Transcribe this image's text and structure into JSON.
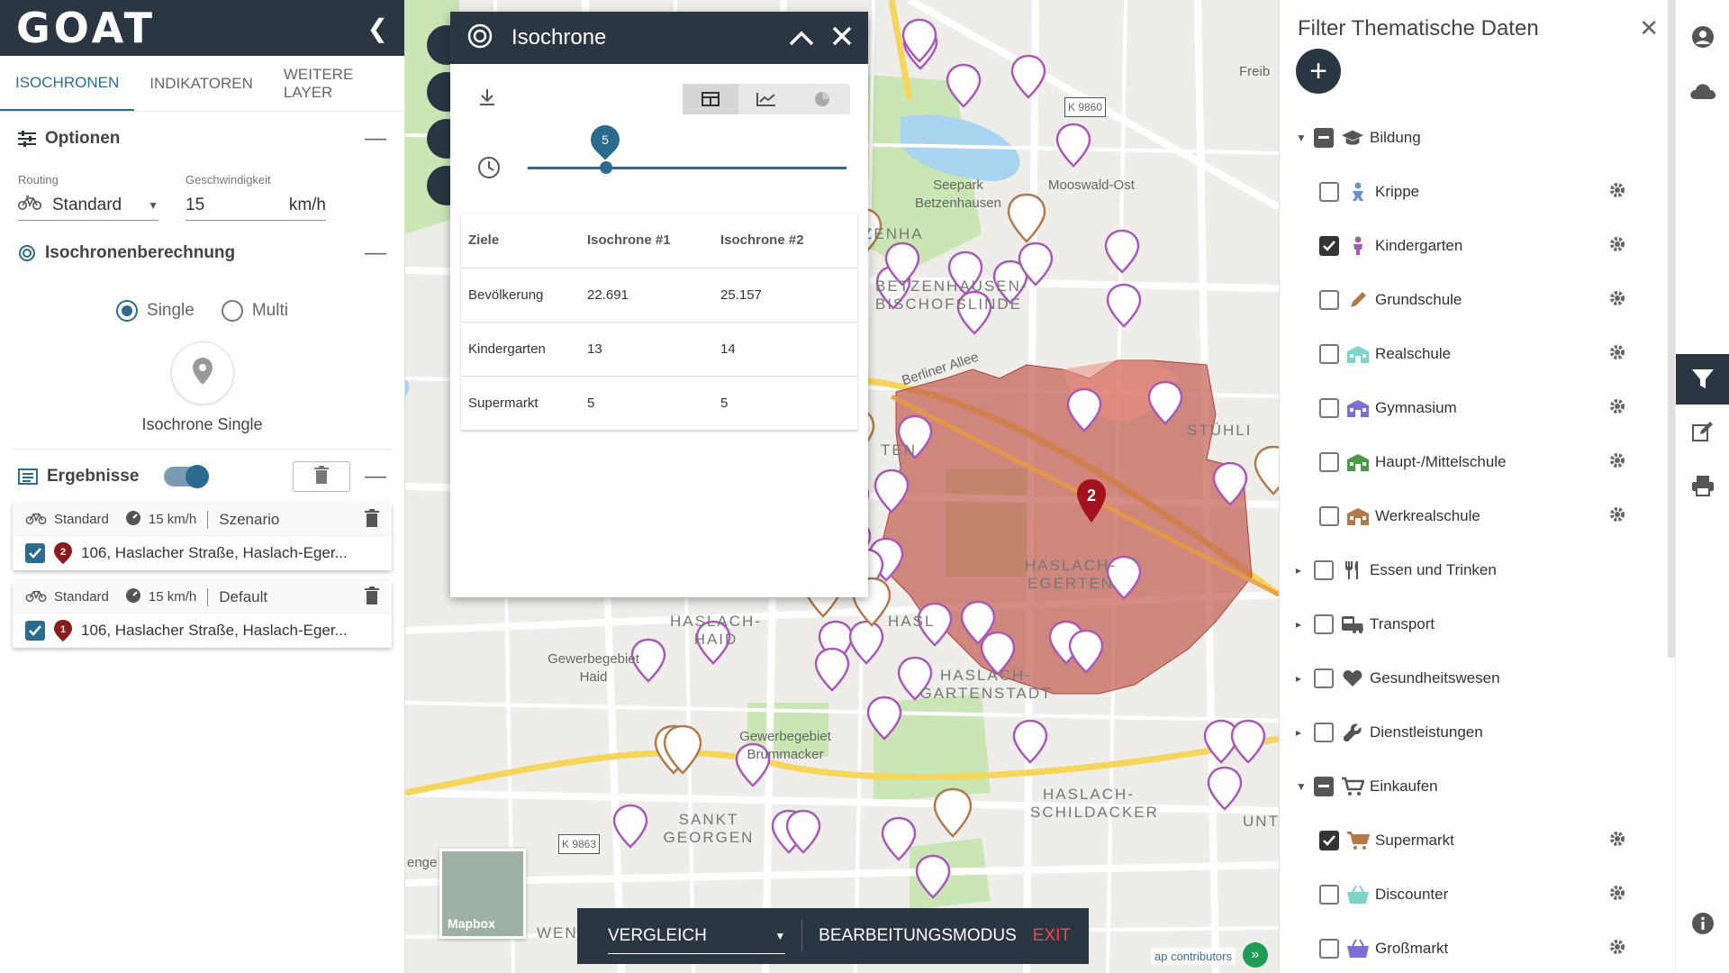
{
  "app": {
    "logo": "GOAT"
  },
  "left": {
    "tabs": [
      "ISOCHRONEN",
      "INDIKATOREN",
      "WEITERE LAYER"
    ],
    "options": {
      "title": "Optionen",
      "routing_label": "Routing",
      "routing_value": "Standard",
      "speed_label": "Geschwindigkeit",
      "speed_value": "15",
      "speed_unit": "km/h"
    },
    "calc": {
      "title": "Isochronenberechnung",
      "single": "Single",
      "multi": "Multi",
      "button_label": "Isochrone Single"
    },
    "results": {
      "title": "Ergebnisse",
      "cards": [
        {
          "routing": "Standard",
          "speed": "15 km/h",
          "name": "Szenario",
          "number": "2",
          "address": "106, Haslacher Straße, Haslach-Eger..."
        },
        {
          "routing": "Standard",
          "speed": "15 km/h",
          "name": "Default",
          "number": "1",
          "address": "106, Haslacher Straße, Haslach-Eger..."
        }
      ]
    }
  },
  "popup": {
    "title": "Isochrone",
    "slider_value": "5",
    "table": {
      "headers": [
        "Ziele",
        "Isochrone #1",
        "Isochrone #2"
      ],
      "rows": [
        [
          "Bevölkerung",
          "22.691",
          "25.157"
        ],
        [
          "Kindergarten",
          "13",
          "14"
        ],
        [
          "Supermarkt",
          "5",
          "5"
        ]
      ]
    }
  },
  "map": {
    "labels": [
      "Seepark Betzenhausen",
      "Mooswald-Ost",
      "Freib",
      "ZENHA",
      "BETZENHAUSEN-BISCHOFSLINDE",
      "STÜHLI",
      "HASLACH-EGERTEN",
      "HASLACH-HAID",
      "HASLACH-GARTENSTADT",
      "Gewerbegebiet Haid",
      "Gewerbegebiet Brummacker",
      "SANKT GEORGEN",
      "HASLACH-SCHILDACKER",
      "UNT",
      "Berliner Allee",
      "K 9860",
      "K 9863",
      "enge",
      "WEN",
      "TEN",
      "HASL"
    ],
    "isochrone_marker": "2",
    "mapbox": "Mapbox",
    "attribution": "ap contributors"
  },
  "bottombar": {
    "select": "VERGLEICH",
    "mode": "BEARBEITUNGSMODUS",
    "exit": "EXIT"
  },
  "filter": {
    "title": "Filter Thematische Daten",
    "groups": [
      {
        "label": "Bildung",
        "state": "partial",
        "expanded": true,
        "items": [
          {
            "label": "Krippe",
            "checked": false
          },
          {
            "label": "Kindergarten",
            "checked": true
          },
          {
            "label": "Grundschule",
            "checked": false
          },
          {
            "label": "Realschule",
            "checked": false
          },
          {
            "label": "Gymnasium",
            "checked": false
          },
          {
            "label": "Haupt-/Mittelschule",
            "checked": false
          },
          {
            "label": "Werkrealschule",
            "checked": false
          }
        ]
      },
      {
        "label": "Essen und Trinken",
        "state": "off",
        "expanded": false,
        "items": []
      },
      {
        "label": "Transport",
        "state": "off",
        "expanded": false,
        "items": []
      },
      {
        "label": "Gesundheitswesen",
        "state": "off",
        "expanded": false,
        "items": []
      },
      {
        "label": "Dienstleistungen",
        "state": "off",
        "expanded": false,
        "items": []
      },
      {
        "label": "Einkaufen",
        "state": "partial",
        "expanded": true,
        "items": [
          {
            "label": "Supermarkt",
            "checked": true
          },
          {
            "label": "Discounter",
            "checked": false
          },
          {
            "label": "Großmarkt",
            "checked": false
          }
        ]
      }
    ]
  }
}
